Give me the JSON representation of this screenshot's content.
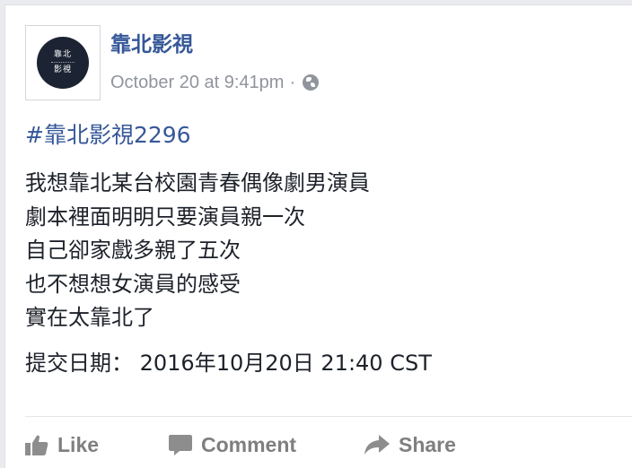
{
  "post": {
    "avatar_text": [
      "靠北",
      "影視"
    ],
    "page_name": "靠北影視",
    "timestamp": "October 20 at 9:41pm",
    "separator": "·",
    "privacy_icon": "globe-icon",
    "hashtag": "#靠北影視2296",
    "lines": [
      "我想靠北某台校園青春偶像劇男演員",
      "劇本裡面明明只要演員親一次",
      "自己卻家戲多親了五次",
      "也不想想女演員的感受",
      "實在太靠北了"
    ],
    "submitted": "提交日期：  2016年10月20日 21:40 CST"
  },
  "actions": {
    "like": "Like",
    "comment": "Comment",
    "share": "Share"
  },
  "colors": {
    "link": "#365899",
    "meta": "#90949c",
    "text": "#1d2129",
    "action": "#7f7f7f"
  }
}
